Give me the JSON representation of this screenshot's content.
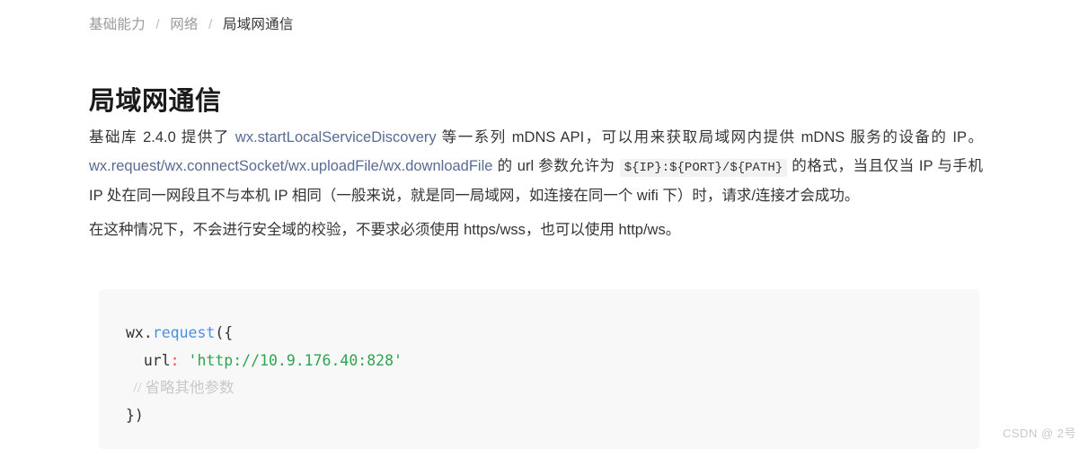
{
  "breadcrumb": {
    "separator": "/",
    "items": [
      {
        "label": "基础能力",
        "current": false
      },
      {
        "label": "网络",
        "current": false
      },
      {
        "label": "局域网通信",
        "current": true
      }
    ]
  },
  "page_title": "局域网通信",
  "paragraphs": {
    "p1": {
      "seg1": "基础库 2.4.0 提供了 ",
      "link1": "wx.startLocalServiceDiscovery",
      "seg2": " 等一系列 mDNS API，可以用来获取局域网内提供 mDNS 服务的设备的 IP。 ",
      "link2": "wx.request",
      "slash1": "/",
      "link3": "wx.connectSocket",
      "slash2": "/",
      "link4": "wx.uploadFile",
      "slash3": "/",
      "link5": "wx.downloadFile",
      "seg3": " 的 url 参数允许为 ",
      "inline_code": "${IP}:${PORT}/${PATH}",
      "seg4": " 的格式，当且仅当 IP 与手机 IP 处在同一网段且不与本机 IP 相同（一般来说，就是同一局域网，如连接在同一个 wifi 下）时，请求/连接才会成功。"
    },
    "p2": {
      "text": "在这种情况下，不会进行安全域的校验，不要求必须使用 https/wss，也可以使用 http/ws。"
    }
  },
  "code_block": {
    "language": "javascript",
    "lines": [
      {
        "tokens": [
          {
            "text": "wx",
            "type": "obj"
          },
          {
            "text": ".",
            "type": "punct"
          },
          {
            "text": "request",
            "type": "fn"
          },
          {
            "text": "({",
            "type": "punct"
          }
        ]
      },
      {
        "tokens": [
          {
            "text": "  url",
            "type": "key"
          },
          {
            "text": ":",
            "type": "colon"
          },
          {
            "text": " ",
            "type": "punct"
          },
          {
            "text": "'http://10.9.176.40:828'",
            "type": "string"
          }
        ]
      },
      {
        "tokens": [
          {
            "text": "  // 省略其他参数",
            "type": "comment"
          }
        ]
      },
      {
        "tokens": [
          {
            "text": "})",
            "type": "punct"
          }
        ]
      }
    ]
  },
  "watermark": "CSDN @ 2号",
  "colors": {
    "link": "#576b95",
    "code_background": "#f8f8f8",
    "inline_code_background": "#f2f2f2",
    "text": "#353535",
    "breadcrumb_muted": "#9a9a9a",
    "string_green": "#2ea44f",
    "function_blue": "#4a90e2",
    "comment_gray": "#c9c9c9"
  }
}
